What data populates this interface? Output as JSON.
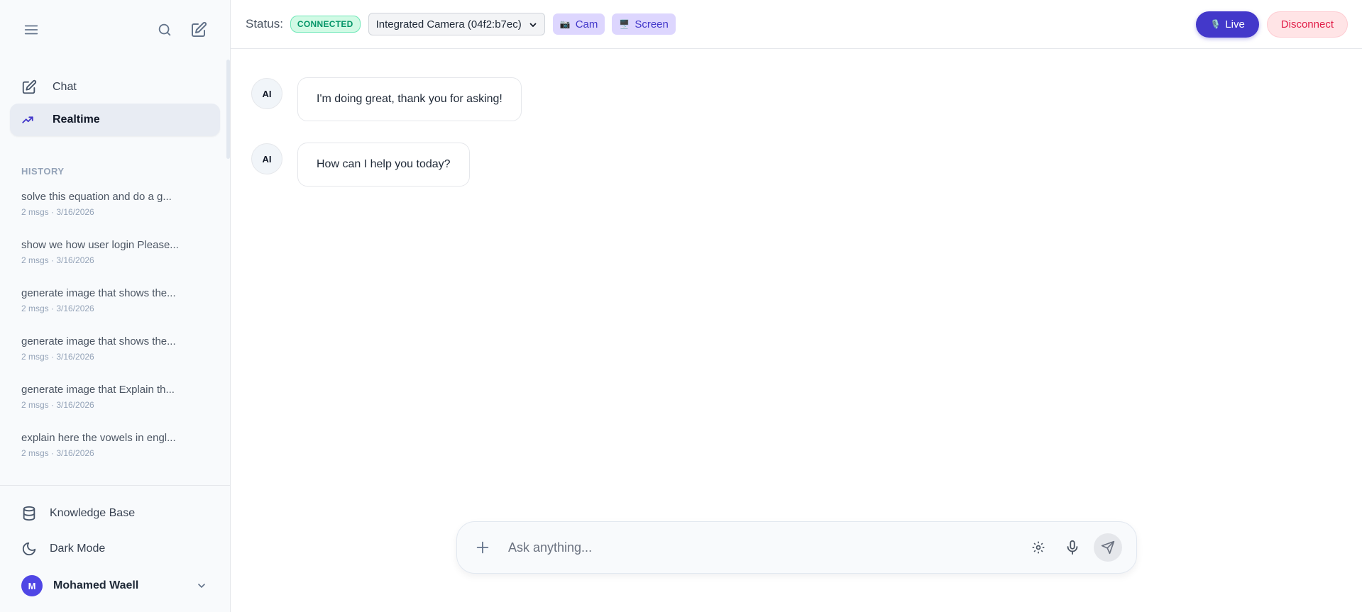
{
  "sidebar": {
    "nav": [
      {
        "label": "Chat",
        "icon": "edit-icon",
        "active": false
      },
      {
        "label": "Realtime",
        "icon": "trend-icon",
        "active": true
      }
    ],
    "history_label": "HISTORY",
    "history": [
      {
        "title": "solve this equation and do a g...",
        "meta": "2 msgs · 3/16/2026"
      },
      {
        "title": "show we how user login Please...",
        "meta": "2 msgs · 3/16/2026"
      },
      {
        "title": "generate image that shows the...",
        "meta": "2 msgs · 3/16/2026"
      },
      {
        "title": "generate image that shows the...",
        "meta": "2 msgs · 3/16/2026"
      },
      {
        "title": "generate image that Explain th...",
        "meta": "2 msgs · 3/16/2026"
      },
      {
        "title": "explain here the vowels in engl...",
        "meta": "2 msgs · 3/16/2026"
      }
    ],
    "knowledge_base": "Knowledge Base",
    "dark_mode": "Dark Mode",
    "user": {
      "initial": "M",
      "name": "Mohamed Waell"
    }
  },
  "topbar": {
    "status_label": "Status:",
    "status_badge": "CONNECTED",
    "camera_select": "Integrated Camera (04f2:b7ec)",
    "cam_label": "Cam",
    "screen_label": "Screen",
    "live_label": "Live",
    "disconnect_label": "Disconnect"
  },
  "messages": [
    {
      "sender": "AI",
      "text": "I'm doing great, thank you for asking!"
    },
    {
      "sender": "AI",
      "text": "How can I help you today?"
    }
  ],
  "composer": {
    "placeholder": "Ask anything..."
  },
  "colors": {
    "accent": "#4338ca",
    "connected": "#059669",
    "disconnect": "#e11d48"
  }
}
